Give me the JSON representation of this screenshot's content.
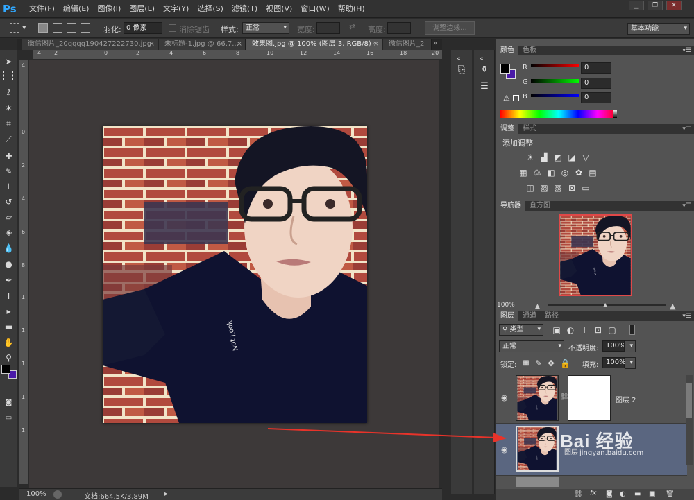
{
  "app": {
    "logo": "Ps"
  },
  "menu": [
    "文件(F)",
    "编辑(E)",
    "图像(I)",
    "图层(L)",
    "文字(Y)",
    "选择(S)",
    "滤镜(T)",
    "视图(V)",
    "窗口(W)",
    "帮助(H)"
  ],
  "window_controls": {
    "minimize": "▁",
    "restore": "❐",
    "close": "✕"
  },
  "options": {
    "feather_label": "羽化:",
    "feather_value": "0 像素",
    "antialias_label": "消除锯齿",
    "style_label": "样式:",
    "style_value": "正常",
    "width_label": "宽度:",
    "height_label": "高度:",
    "refine_edge": "调整边缘...",
    "workspace": "基本功能"
  },
  "tabs": [
    {
      "label": "微信图片_20qqqq190427222730.jpg",
      "active": false
    },
    {
      "label": "未标题-1.jpg @ 66.7...",
      "active": false
    },
    {
      "label": "效果图.jpg @ 100% (图层 3, RGB/8) *",
      "active": true
    },
    {
      "label": "微信图片_2",
      "active": false
    }
  ],
  "status": {
    "zoom": "100%",
    "doc_size": "文档:664.5K/3.89M"
  },
  "color_panel": {
    "tabs": [
      "颜色",
      "色板"
    ],
    "r_label": "R",
    "g_label": "G",
    "b_label": "B",
    "r_value": "0",
    "g_value": "0",
    "b_value": "0",
    "foreground": "#000000",
    "background": "#4a1aa8"
  },
  "adjust_panel": {
    "tabs": [
      "调整",
      "样式"
    ],
    "title": "添加调整"
  },
  "navigator": {
    "tabs": [
      "导航器",
      "直方图"
    ],
    "zoom": "100%"
  },
  "layers_panel": {
    "tabs": [
      "图层",
      "通道",
      "路径"
    ],
    "filter_kind": "类型",
    "blend_mode": "正常",
    "opacity_label": "不透明度:",
    "opacity_value": "100%",
    "lock_label": "锁定:",
    "fill_label": "填充:",
    "fill_value": "100%",
    "layers": [
      {
        "name": "图层 2",
        "selected": false,
        "has_mask": true
      },
      {
        "name": "图层",
        "selected": true,
        "has_mask": false
      }
    ],
    "footer_icons": [
      "fx"
    ]
  },
  "watermark": {
    "text": "Bai 经验",
    "url": "jingyan.baidu.com"
  },
  "colors": {
    "arrow": "#e8332a",
    "panel_bg": "#535353",
    "canvas_bg": "#3d3939"
  }
}
